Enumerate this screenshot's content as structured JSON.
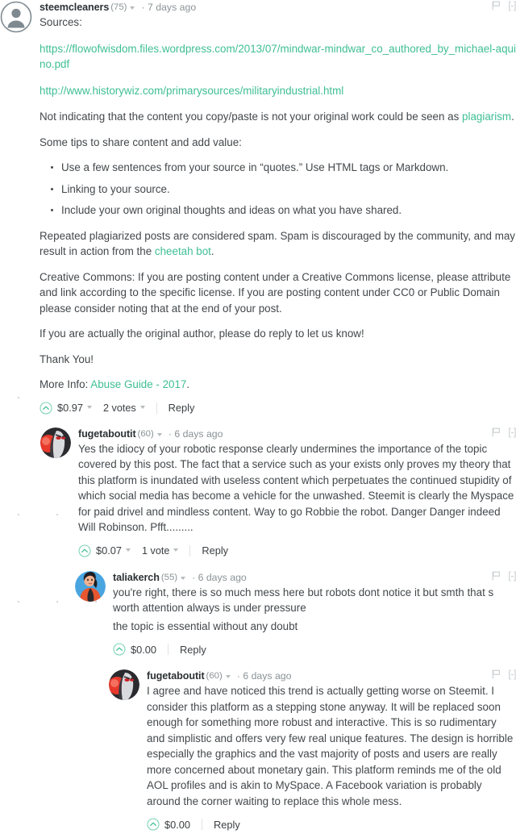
{
  "thread": {
    "comments": [
      {
        "depth": 0,
        "author": "steemcleaners",
        "reputation": "(75)",
        "age": "· 7 days ago",
        "collapse": "[-]",
        "avatar": "default-person-avatar",
        "body": {
          "sources_label": "Sources:",
          "link1": "https://flowofwisdom.files.wordpress.com/2013/07/mindwar-mindwar_co_authored_by_michael-aquino.pdf",
          "link2": "http://www.historywiz.com/primarysources/militaryindustrial.html",
          "para_plagiarism_pre": "Not indicating that the content you copy/paste is not your original work could be seen as ",
          "para_plagiarism_link": "plagiarism",
          "para_plagiarism_post": ".",
          "tips_intro": "Some tips to share content and add value:",
          "tips": [
            "Use a few sentences from your source in “quotes.” Use HTML tags or Markdown.",
            "Linking to your source.",
            "Include your own original thoughts and ideas on what you have shared."
          ],
          "para_spam_pre": "Repeated plagiarized posts are considered spam. Spam is discouraged by the community, and may result in action from the ",
          "para_spam_link": "cheetah bot",
          "para_spam_post": ".",
          "para_cc": "Creative Commons: If you are posting content under a Creative Commons license, please attribute and link according to the specific license. If you are posting content under CC0 or Public Domain please consider noting that at the end of your post.",
          "para_author": "If you are actually the original author, please do reply to let us know!",
          "para_thanks": "Thank You!",
          "more_info_pre": "More Info: ",
          "more_info_link": "Abuse Guide - 2017",
          "more_info_post": "."
        },
        "footer": {
          "payout": "$0.97",
          "has_payout_caret": true,
          "votes": "2 votes",
          "has_votes": true,
          "reply": "Reply"
        }
      },
      {
        "depth": 1,
        "author": "fugetaboutit",
        "reputation": "(60)",
        "age": "· 6 days ago",
        "collapse": "[-]",
        "avatar": "dark-cartoon-face-avatar",
        "body": {
          "text": "Yes the idiocy of your robotic response clearly undermines the importance of the topic covered by this post. The fact that a service such as your exists only proves my theory that this platform is inundated with useless content which perpetuates the continued stupidity of which social media has become a vehicle for the unwashed. Steemit is clearly the Myspace for paid drivel and mindless content. Way to go Robbie the robot. Danger Danger indeed Will Robinson. Pfft........."
        },
        "footer": {
          "payout": "$0.07",
          "has_payout_caret": true,
          "votes": "1 vote",
          "has_votes": true,
          "reply": "Reply"
        }
      },
      {
        "depth": 2,
        "author": "taliakerch",
        "reputation": "(55)",
        "age": "· 6 days ago",
        "collapse": "[-]",
        "avatar": "woman-photo-avatar",
        "body": {
          "line1": "you're right, there is so much mess here but robots dont notice it but smth that s worth attention always is under pressure",
          "line2": "the topic is essential without any doubt"
        },
        "footer": {
          "payout": "$0.00",
          "has_payout_caret": false,
          "votes": "",
          "has_votes": false,
          "reply": "Reply"
        }
      },
      {
        "depth": 3,
        "author": "fugetaboutit",
        "reputation": "(60)",
        "age": "· 6 days ago",
        "collapse": "[-]",
        "avatar": "dark-cartoon-face-avatar",
        "body": {
          "text": "I agree and have noticed this trend is actually getting worse on Steemit. I consider this platform as a stepping stone anyway. It will be replaced soon enough for something more robust and interactive. This is so rudimentary and simplistic and offers very few real unique features. The design is horrible especially the graphics and the vast majority of posts and users are really more concerned about monetary gain. This platform reminds me of the old AOL profiles and is akin to MySpace. A Facebook variation is probably around the corner waiting to replace this whole mess."
        },
        "footer": {
          "payout": "$0.00",
          "has_payout_caret": false,
          "votes": "",
          "has_votes": false,
          "reply": "Reply"
        }
      }
    ]
  },
  "colors": {
    "link": "#3fbe95",
    "upvote": "#3fbe95",
    "text": "#43484b",
    "muted": "#8a9396"
  }
}
